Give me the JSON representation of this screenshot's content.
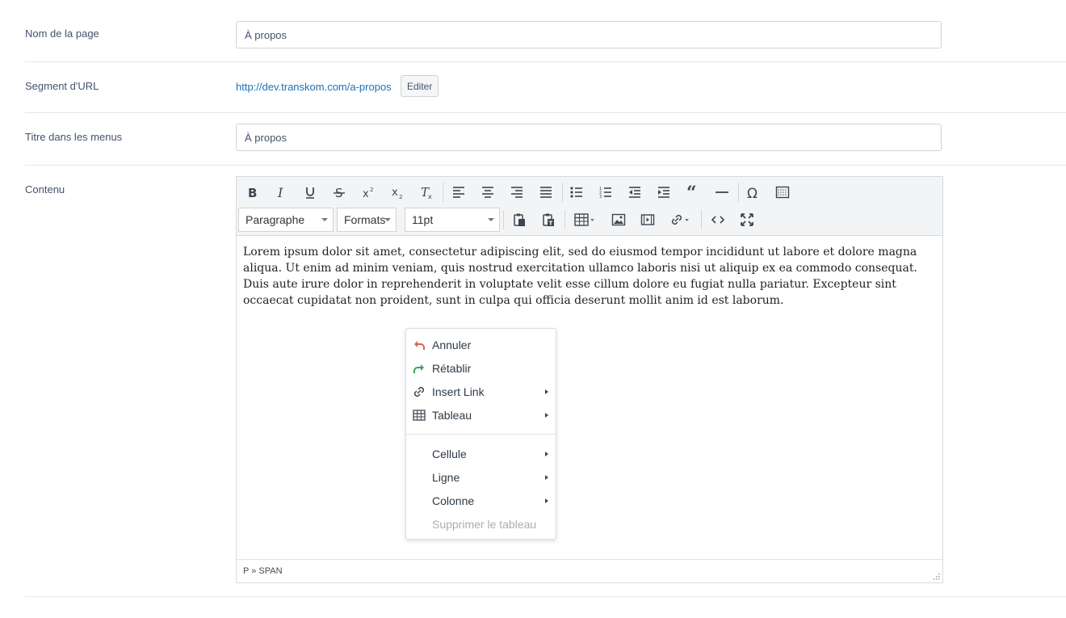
{
  "form": {
    "page_name": {
      "label": "Nom de la page",
      "value": "À propos"
    },
    "url_segment": {
      "label": "Segment d'URL",
      "url": "http://dev.transkom.com/a-propos",
      "edit_label": "Editer"
    },
    "menu_title": {
      "label": "Titre dans les menus",
      "value": "À propos"
    },
    "content": {
      "label": "Contenu"
    }
  },
  "editor": {
    "block_format": "Paragraphe",
    "formats": "Formats",
    "font_size": "11pt",
    "body_text": "Lorem ipsum dolor sit amet, consectetur adipiscing elit, sed do eiusmod tempor incididunt ut labore et dolore magna aliqua. Ut enim ad minim veniam, quis nostrud exercitation ullamco laboris nisi ut aliquip ex ea commodo consequat. Duis aute irure dolor in reprehenderit in voluptate velit esse cillum dolore eu fugiat nulla pariatur. Excepteur sint occaecat cupidatat non proident, sunt in culpa qui officia deserunt mollit anim id est laborum.",
    "path": "P » SPAN"
  },
  "context_menu": {
    "undo": "Annuler",
    "redo": "Rétablir",
    "insert_link": "Insert Link",
    "table": "Tableau",
    "cell": "Cellule",
    "row": "Ligne",
    "column": "Colonne",
    "delete_table": "Supprimer le tableau"
  },
  "colors": {
    "link": "#1d6fb8",
    "undo_icon": "#d9654b",
    "redo_icon": "#3aa55a",
    "label": "#43536d"
  }
}
